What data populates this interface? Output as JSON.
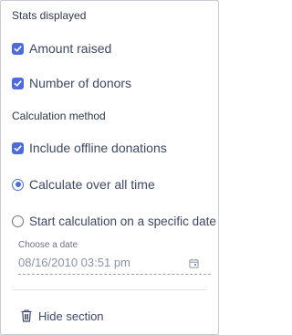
{
  "stats": {
    "title": "Stats displayed",
    "amount_raised": "Amount raised",
    "number_of_donors": "Number of donors"
  },
  "calculation": {
    "title": "Calculation method",
    "include_offline": "Include offline donations",
    "over_all_time": "Calculate over all time",
    "specific_date": "Start calculation on a specific date"
  },
  "date": {
    "label": "Choose a date",
    "value": "08/16/2010 03:51 pm"
  },
  "footer": {
    "hide_section": "Hide section"
  },
  "colors": {
    "accent": "#4d6cd9",
    "text": "#3d4863",
    "muted": "#8d93a3"
  },
  "state": {
    "amount_raised_checked": true,
    "number_of_donors_checked": true,
    "include_offline_checked": true,
    "selected_method": "Calculate over all time"
  }
}
